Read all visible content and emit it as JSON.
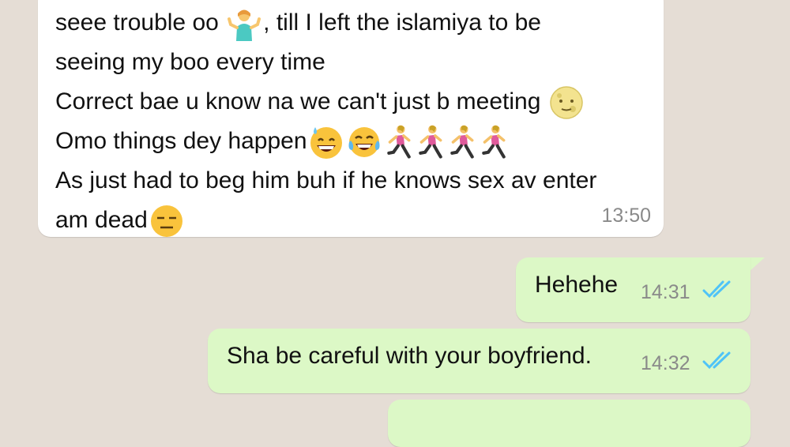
{
  "incoming_message": {
    "lines": [
      {
        "before": "seee trouble oo ",
        "emoji": "person-shrugging-emoji",
        "after": ", till I left the islamiya to be"
      },
      {
        "text": "seeing my boo every time"
      },
      {
        "text": "Correct bae u know na we can't just b meeting ",
        "emoji": "moon-face-emoji"
      },
      {
        "text": "Omo things dey happen",
        "emojis": [
          "grinning-sweat-emoji",
          "tears-of-joy-emoji",
          "woman-running-emoji",
          "woman-running-emoji",
          "woman-running-emoji",
          "woman-running-emoji"
        ]
      },
      {
        "text": "As just had to beg him buh if he knows sex av enter"
      },
      {
        "text": "am dead",
        "emoji": "expressionless-face-emoji"
      }
    ],
    "time": "13:50"
  },
  "outgoing_messages": [
    {
      "text": "Hehehe",
      "time": "14:31",
      "status": "read"
    },
    {
      "text": "Sha be careful with your boyfriend.",
      "time": "14:32",
      "status": "read"
    }
  ],
  "colors": {
    "background": "#e5ddd5",
    "incoming_bubble": "#ffffff",
    "outgoing_bubble": "#dcf8c6",
    "read_ticks": "#4fc3f7",
    "timestamp": "#8a8a8a"
  }
}
